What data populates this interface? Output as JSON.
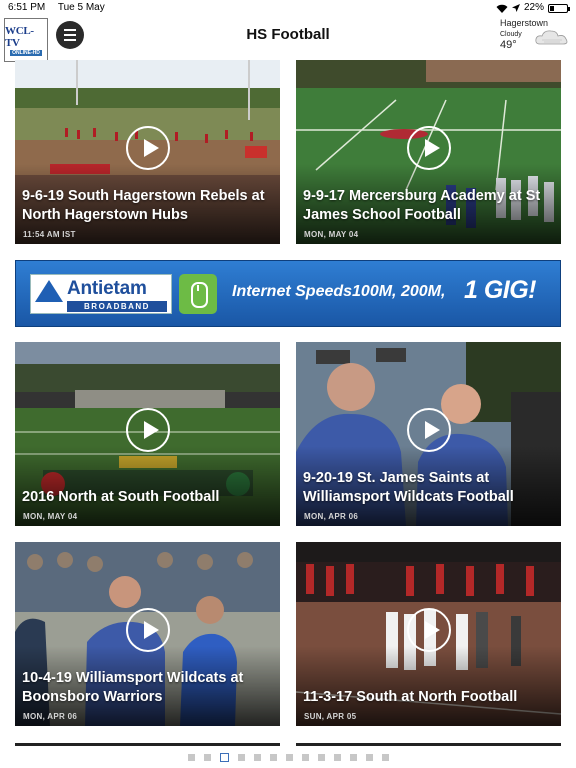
{
  "status": {
    "time": "6:51 PM",
    "date": "Tue 5 May",
    "battery": "22%",
    "battery_level": 0.22
  },
  "header": {
    "logo_text": "WCL-TV",
    "logo_sub": "ONLINE-HD",
    "title": "HS Football",
    "weather": {
      "city": "Hagerstown",
      "condition": "Cloudy",
      "temp": "49°",
      "icon": "cloud-icon"
    }
  },
  "videos": [
    {
      "title": "9-6-19 South Hagerstown Rebels at North Hagerstown Hubs",
      "date": "11:54 AM IST"
    },
    {
      "title": "9-9-17 Mercersburg Academy at St James School Football",
      "date": "MON, MAY 04"
    },
    {
      "title": "2016 North at South Football",
      "date": "MON, MAY 04"
    },
    {
      "title": "9-20-19 St. James Saints at Williamsport Wildcats Football",
      "date": "MON, APR 06"
    },
    {
      "title": "10-4-19 Williamsport Wildcats at Boonsboro Warriors",
      "date": "MON, APR 06"
    },
    {
      "title": "11-3-17 South at North Football",
      "date": "SUN, APR 05"
    }
  ],
  "ad": {
    "brand": "Antietam",
    "brand_sub": "BROADBAND",
    "tagline": "Internet Speeds100M, 200M,",
    "highlight": "1 GIG!"
  },
  "pager": {
    "count": 13,
    "active_index": 2
  },
  "colors": {
    "accent": "#3d6fb8",
    "ad_blue": "#1a57a6",
    "ad_green": "#6dbb45"
  }
}
